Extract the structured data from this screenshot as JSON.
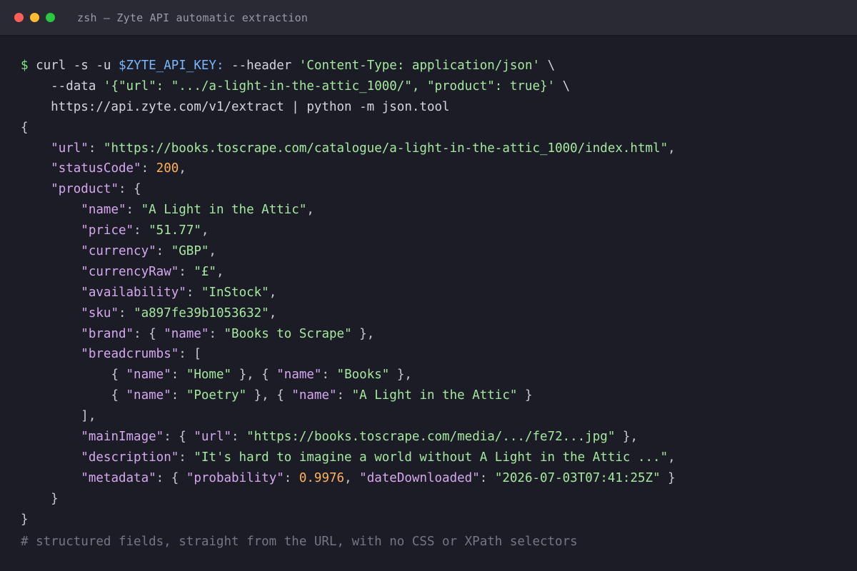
{
  "window": {
    "title": "zsh — Zyte API automatic extraction",
    "controls": {
      "close_color": "#ff5f57",
      "minimize_color": "#febc2e",
      "maximize_color": "#28c840"
    }
  },
  "terminal": {
    "command": {
      "prompt": "$",
      "line1_a": "curl -s -u ",
      "line1_var": "$ZYTE_API_KEY:",
      "line1_b": " --header ",
      "line1_header": "'Content-Type: application/json'",
      "line1_cont": " \\",
      "line2_a": "    --data ",
      "line2_data": "'{\"url\": \".../a-light-in-the-attic_1000/\", \"product\": true}'",
      "line2_cont": " \\",
      "line3": "    https://api.zyte.com/v1/extract | python -m json.tool"
    },
    "response": {
      "url_key": "\"url\"",
      "url_value": "\"https://books.toscrape.com/catalogue/a-light-in-the-attic_1000/index.html\"",
      "status_key": "\"statusCode\"",
      "status_value": "200",
      "product_key": "\"product\"",
      "name_key": "\"name\"",
      "name_value": "\"A Light in the Attic\"",
      "price_key": "\"price\"",
      "price_value": "\"51.77\"",
      "currency_key": "\"currency\"",
      "currency_value": "\"GBP\"",
      "currencyraw_key": "\"currencyRaw\"",
      "currencyraw_value": "\"£\"",
      "availability_key": "\"availability\"",
      "availability_value": "\"InStock\"",
      "sku_key": "\"sku\"",
      "sku_value": "\"a897fe39b1053632\"",
      "brand_key": "\"brand\"",
      "brand_name_key": "\"name\"",
      "brand_name_value": "\"Books to Scrape\"",
      "breadcrumbs_key": "\"breadcrumbs\"",
      "crumb_name_key": "\"name\"",
      "crumb1": "\"Home\"",
      "crumb2": "\"Books\"",
      "crumb3": "\"Poetry\"",
      "crumb4": "\"A Light in the Attic\"",
      "mainimage_key": "\"mainImage\"",
      "mainimage_url_key": "\"url\"",
      "mainimage_url_value": "\"https://books.toscrape.com/media/.../fe72...jpg\"",
      "description_key": "\"description\"",
      "description_value": "\"It's hard to imagine a world without A Light in the Attic ...\"",
      "metadata_key": "\"metadata\"",
      "probability_key": "\"probability\"",
      "probability_value": "0.9976",
      "datedownloaded_key": "\"dateDownloaded\"",
      "datedownloaded_value": "\"2026-07-03T07:41:25Z\""
    },
    "comment": "# structured fields, straight from the URL, with no CSS or XPath selectors"
  }
}
